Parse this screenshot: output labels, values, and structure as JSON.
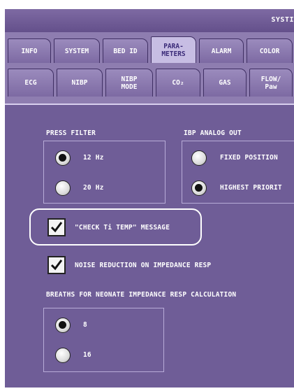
{
  "titlebar": {
    "title": "SYSTI"
  },
  "tabs_row1": [
    {
      "label": "INFO"
    },
    {
      "label": "SYSTEM"
    },
    {
      "label": "BED ID"
    },
    {
      "label": "PARA-\nMETERS",
      "active": true
    },
    {
      "label": "ALARM"
    },
    {
      "label": "COLOR"
    }
  ],
  "tabs_row2": [
    {
      "label": "ECG"
    },
    {
      "label": "NIBP"
    },
    {
      "label": "NIBP\nMODE"
    },
    {
      "label": "CO₂"
    },
    {
      "label": "GAS"
    },
    {
      "label": "FLOW/\nPaw"
    }
  ],
  "press_filter": {
    "label": "PRESS FILTER",
    "options": [
      {
        "label": "12 Hz",
        "selected": true
      },
      {
        "label": "20 Hz",
        "selected": false
      }
    ]
  },
  "ibp_analog_out": {
    "label": "IBP ANALOG OUT",
    "options": [
      {
        "label": "FIXED POSITION",
        "selected": false
      },
      {
        "label": "HIGHEST PRIORIT",
        "selected": true
      }
    ]
  },
  "check_ti_temp": {
    "label": "\"CHECK Ti TEMP\" MESSAGE",
    "checked": true
  },
  "noise_reduction": {
    "label": "NOISE REDUCTION ON IMPEDANCE RESP",
    "checked": true
  },
  "breaths_neonate": {
    "label": "BREATHS FOR NEONATE IMPEDANCE RESP CALCULATION",
    "options": [
      {
        "label": "8",
        "selected": true
      },
      {
        "label": "16",
        "selected": false
      }
    ]
  },
  "colors": {
    "panel": "#6f5d97",
    "active_tab": "#c7bde3",
    "tab": "#8e7db0"
  }
}
